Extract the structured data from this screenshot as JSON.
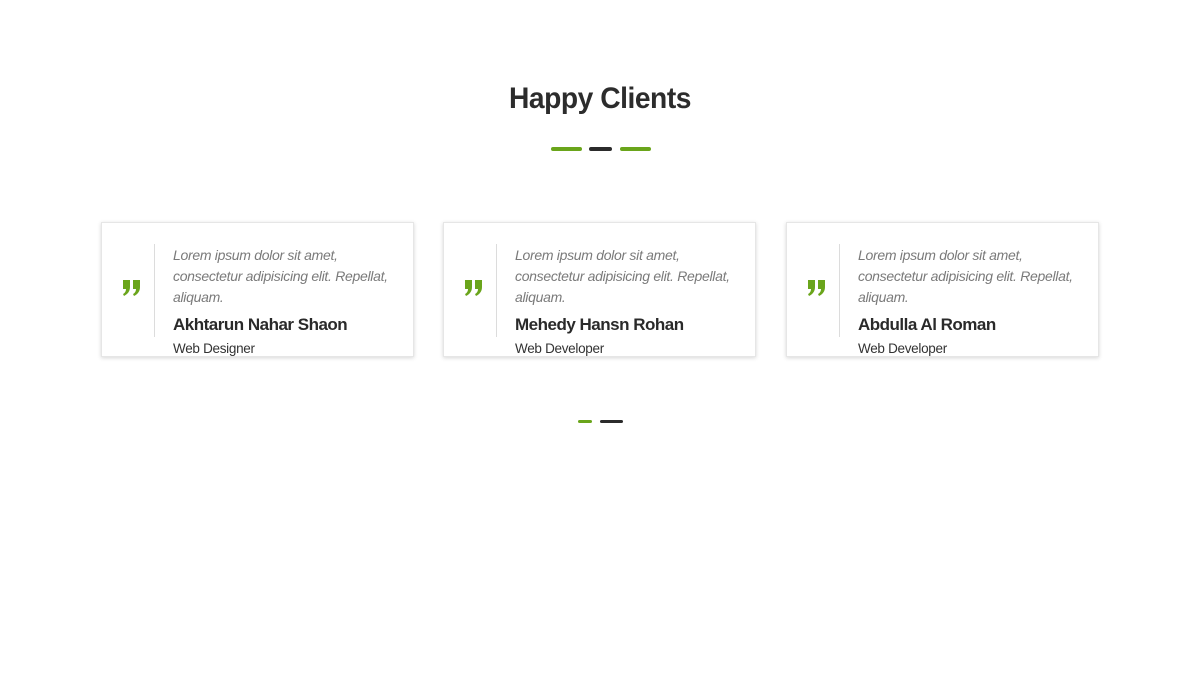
{
  "section": {
    "title": "Happy Clients"
  },
  "colors": {
    "accent": "#6aa51b",
    "dark": "#2b2b2b"
  },
  "testimonials": [
    {
      "quote": "Lorem ipsum dolor sit amet, consectetur adipisicing elit. Repellat, aliquam.",
      "name": "Akhtarun Nahar Shaon",
      "role": "Web Designer",
      "icon": "quote-icon"
    },
    {
      "quote": "Lorem ipsum dolor sit amet, consectetur adipisicing elit. Repellat, aliquam.",
      "name": "Mehedy Hansn Rohan",
      "role": "Web Developer",
      "icon": "quote-icon"
    },
    {
      "quote": "Lorem ipsum dolor sit amet, consectetur adipisicing elit. Repellat, aliquam.",
      "name": "Abdulla Al Roman",
      "role": "Web Developer",
      "icon": "quote-icon"
    }
  ],
  "pager": {
    "pages": 2,
    "active_page": 1
  }
}
